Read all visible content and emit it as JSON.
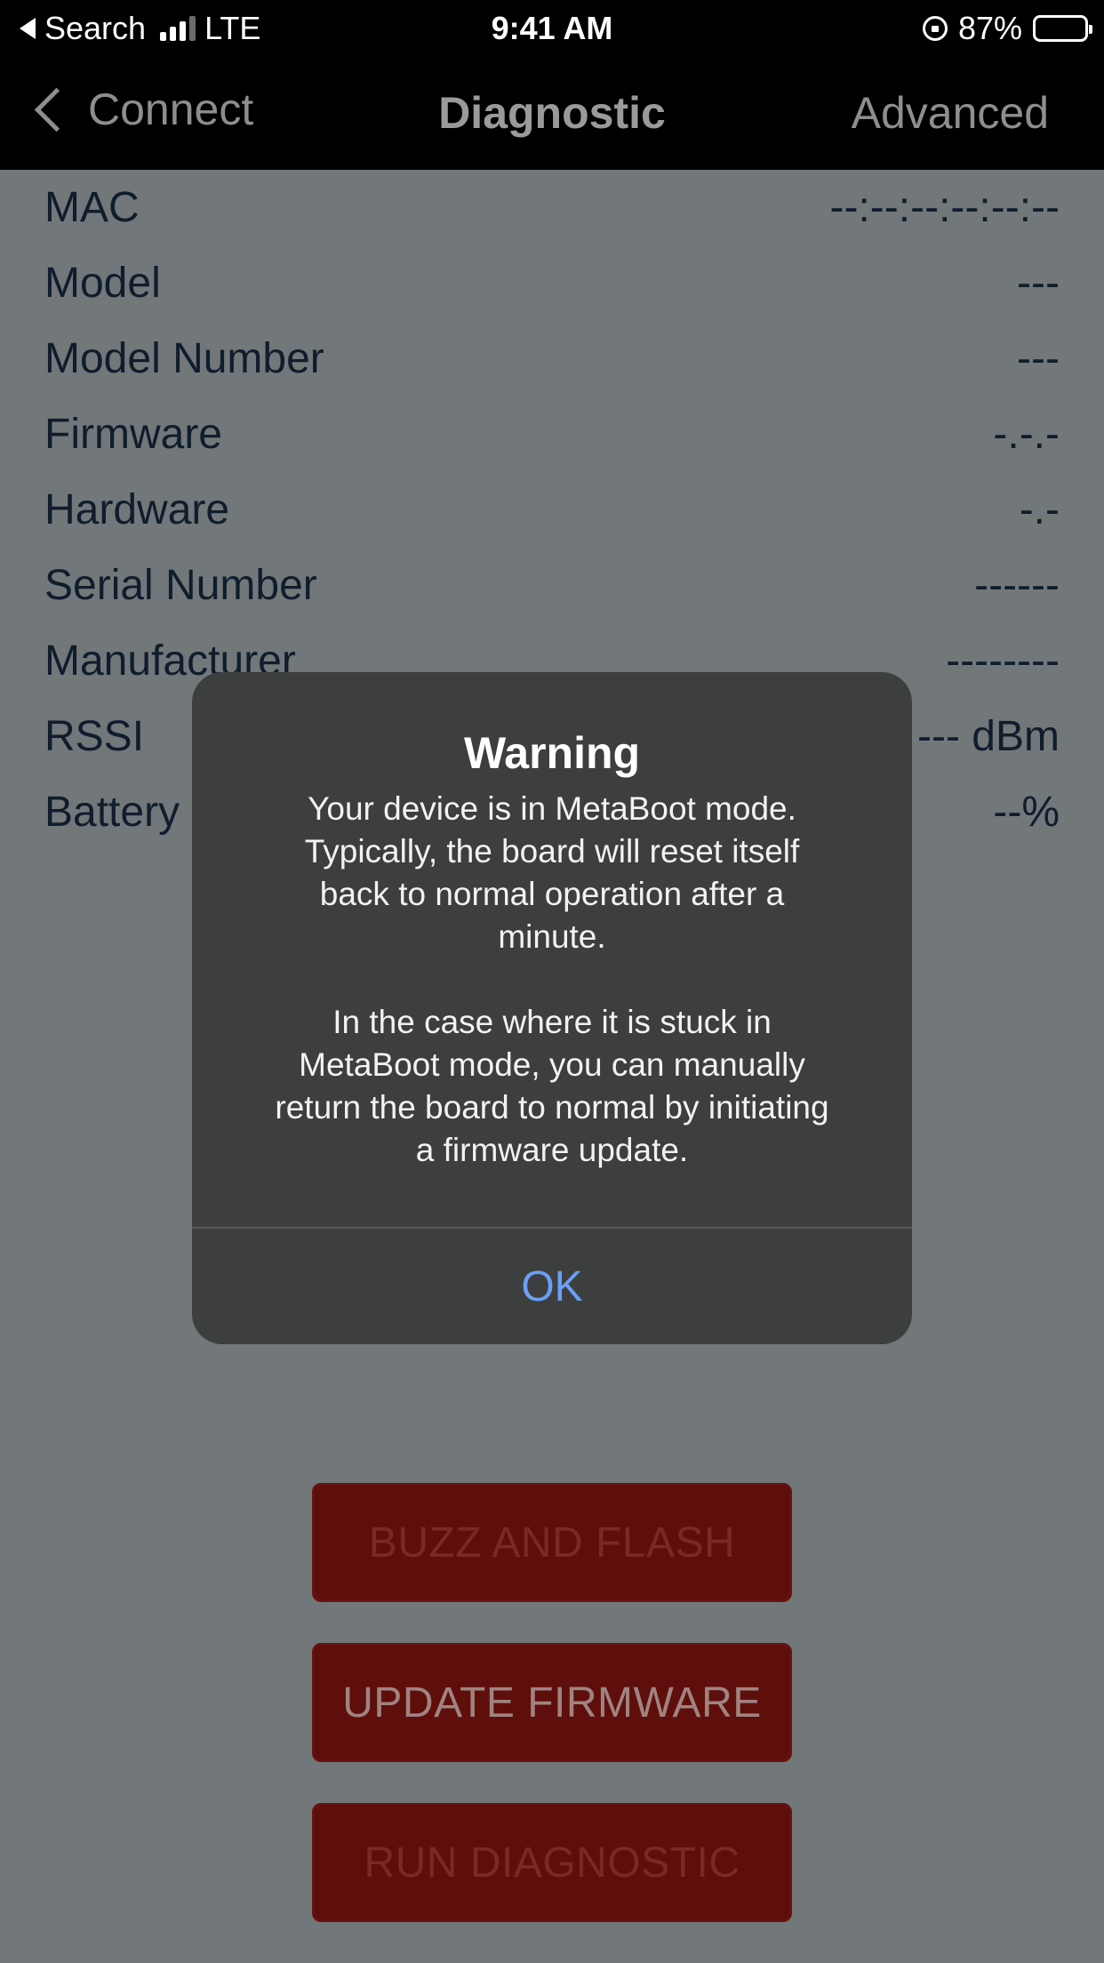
{
  "status_bar": {
    "back_app": "Search",
    "network": "LTE",
    "time": "9:41 AM",
    "battery_pct": "87%",
    "battery_level": 0.87,
    "signal_bars": 3
  },
  "nav": {
    "back_label": "Connect",
    "title": "Diagnostic",
    "right_label": "Advanced"
  },
  "info_rows": [
    {
      "label": "MAC",
      "value": "--:--:--:--:--:--"
    },
    {
      "label": "Model",
      "value": "---"
    },
    {
      "label": "Model Number",
      "value": "---"
    },
    {
      "label": "Firmware",
      "value": "-.-.-"
    },
    {
      "label": "Hardware",
      "value": "-.-"
    },
    {
      "label": "Serial Number",
      "value": "------"
    },
    {
      "label": "Manufacturer",
      "value": "--------"
    },
    {
      "label": "RSSI",
      "value": "--- dBm"
    },
    {
      "label": "Battery",
      "value": "--%"
    }
  ],
  "buttons": {
    "buzz": "BUZZ AND FLASH",
    "update": "UPDATE FIRMWARE",
    "run": "RUN DIAGNOSTIC"
  },
  "alert": {
    "title": "Warning",
    "message": "Your device is in MetaBoot mode.\nTypically, the board will reset itself\nback to normal operation after a\nminute.\n\nIn the case where it is stuck in\nMetaBoot mode, you can manually\nreturn the board to normal by initiating\na firmware update.",
    "ok_label": "OK"
  },
  "colors": {
    "background": "#72787a",
    "button_bg": "#5e0f0b",
    "alert_bg": "#3d3f3f",
    "ok_blue": "#6aa0f5"
  }
}
